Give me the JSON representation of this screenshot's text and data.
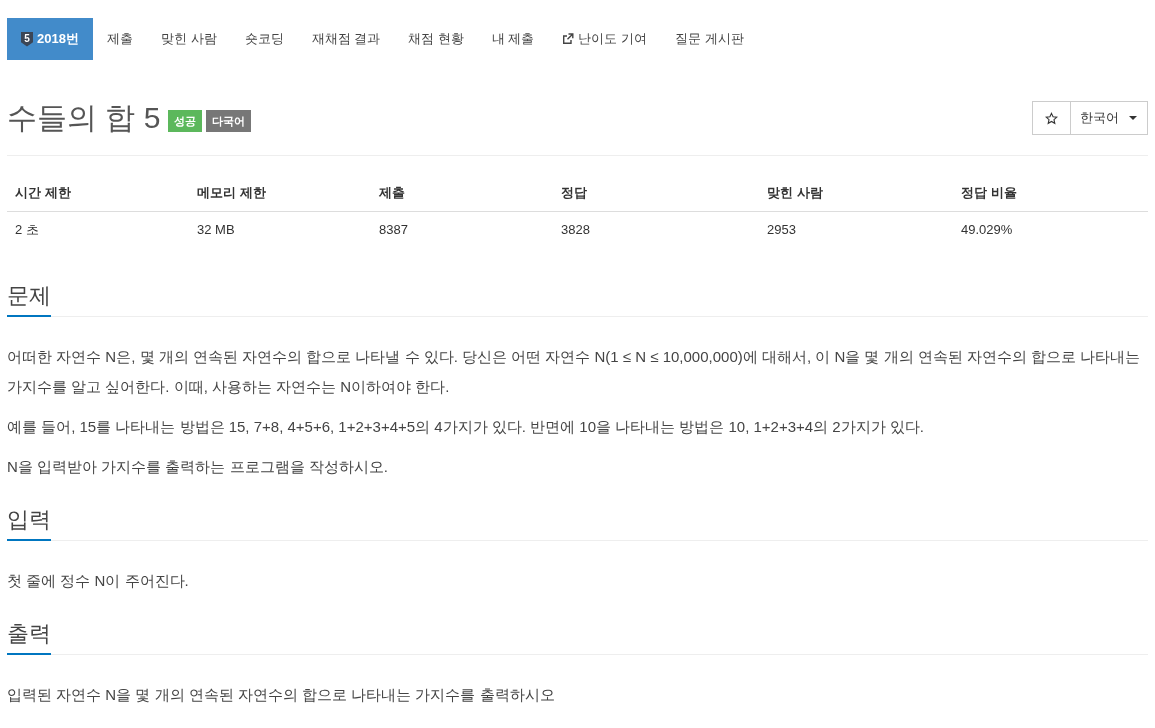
{
  "nav_tabs": [
    {
      "kind": "problem",
      "badge": "5",
      "label": "2018번",
      "selected": true
    },
    {
      "kind": "link",
      "label": "제출",
      "selected": false
    },
    {
      "kind": "link",
      "label": "맞힌 사람",
      "selected": false
    },
    {
      "kind": "link",
      "label": "숏코딩",
      "selected": false
    },
    {
      "kind": "link",
      "label": "재채점 결과",
      "selected": false
    },
    {
      "kind": "link",
      "label": "채점 현황",
      "selected": false
    },
    {
      "kind": "link",
      "label": "내 제출",
      "selected": false
    },
    {
      "kind": "external",
      "label": "난이도 기여",
      "selected": false
    },
    {
      "kind": "link",
      "label": "질문 게시판",
      "selected": false
    }
  ],
  "title": "수들의 합 5",
  "badges": [
    {
      "label": "성공",
      "color": "#5cb85c"
    },
    {
      "label": "다국어",
      "color": "#777777"
    }
  ],
  "language_select": {
    "value": "한국어"
  },
  "stats_table": {
    "columns": [
      "시간 제한",
      "메모리 제한",
      "제출",
      "정답",
      "맞힌 사람",
      "정답 비율"
    ],
    "rows": [
      [
        "2 초",
        "32 MB",
        "8387",
        "3828",
        "2953",
        "49.029%"
      ]
    ]
  },
  "sections": [
    {
      "heading": "문제",
      "paragraphs": [
        "어떠한 자연수 N은, 몇 개의 연속된 자연수의 합으로 나타낼 수 있다. 당신은 어떤 자연수 N(1 ≤ N ≤ 10,000,000)에 대해서, 이 N을 몇 개의 연속된 자연수의 합으로 나타내는 가지수를 알고 싶어한다. 이때, 사용하는 자연수는 N이하여야 한다.",
        "예를 들어, 15를 나타내는 방법은 15, 7+8, 4+5+6, 1+2+3+4+5의 4가지가 있다. 반면에 10을 나타내는 방법은 10, 1+2+3+4의 2가지가 있다.",
        "N을 입력받아 가지수를 출력하는 프로그램을 작성하시오."
      ]
    },
    {
      "heading": "입력",
      "paragraphs": [
        "첫 줄에 정수 N이 주어진다."
      ]
    },
    {
      "heading": "출력",
      "paragraphs": [
        "입력된 자연수 N을 몇 개의 연속된 자연수의 합으로 나타내는 가지수를 출력하시오"
      ]
    }
  ]
}
